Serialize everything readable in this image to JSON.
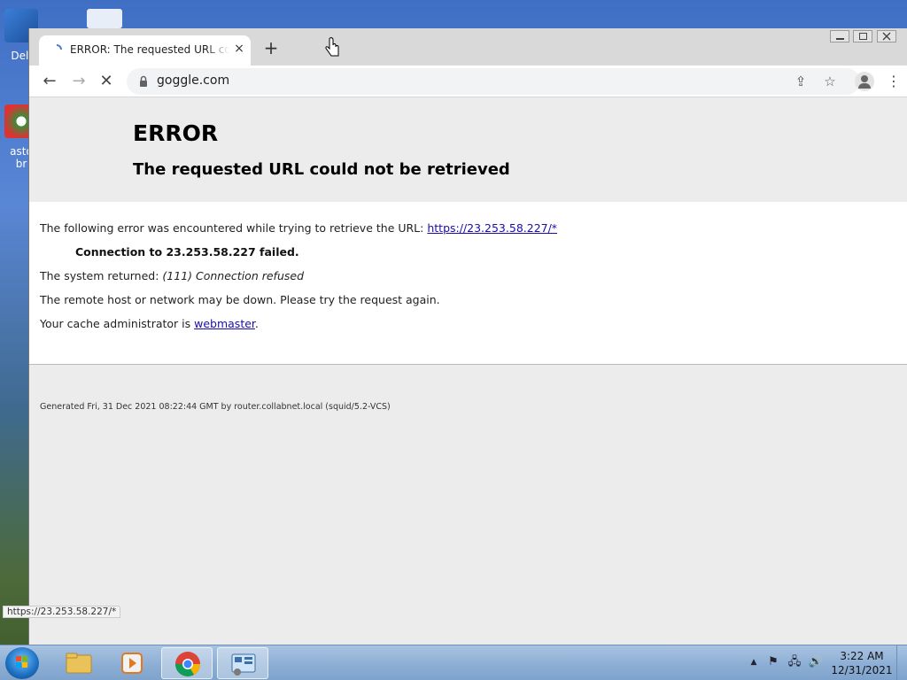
{
  "desktop": {
    "icons": [
      {
        "label": "Dell",
        "icon": "computer-icon"
      },
      {
        "label": "asto br",
        "icon": "browser-shortcut-icon"
      }
    ]
  },
  "browser": {
    "tab": {
      "title": "ERROR: The requested URL could not be retrieved",
      "close": "×"
    },
    "new_tab": "+",
    "address": "goggle.com",
    "controls": {
      "back": "←",
      "forward": "→",
      "reload": "✕",
      "share": "⇪",
      "bookmark": "☆",
      "menu": "⋮"
    },
    "status_url": "https://23.253.58.227/*"
  },
  "page": {
    "title": "ERROR",
    "subtitle": "The requested URL could not be retrieved",
    "line1_prefix": "The following error was encountered while trying to retrieve the URL: ",
    "line1_link": "https://23.253.58.227/*",
    "connection_failed": "Connection to 23.253.58.227 failed.",
    "system_returned_prefix": "The system returned: ",
    "system_returned_value": "(111) Connection refused",
    "remote_host": "The remote host or network may be down. Please try the request again.",
    "cache_admin_prefix": "Your cache administrator is ",
    "cache_admin_link": "webmaster",
    "cache_admin_suffix": ".",
    "footer": "Generated Fri, 31 Dec 2021 08:22:44 GMT by router.collabnet.local (squid/5.2-VCS)"
  },
  "taskbar": {
    "apps": [
      {
        "name": "File Explorer",
        "icon": "folder-icon"
      },
      {
        "name": "Media Player",
        "icon": "media-player-icon"
      },
      {
        "name": "Google Chrome",
        "icon": "chrome-icon",
        "active": true
      },
      {
        "name": "Control Panel",
        "icon": "control-panel-icon"
      }
    ],
    "tray": {
      "chevron": "▲",
      "flag": "⚑",
      "network": "🖧",
      "volume": "🔊"
    },
    "clock": {
      "time": "3:22 AM",
      "date": "12/31/2021"
    }
  },
  "colors": {
    "link": "#1a0dab",
    "page_bg": "#ececec",
    "content_bg": "#ffffff"
  }
}
